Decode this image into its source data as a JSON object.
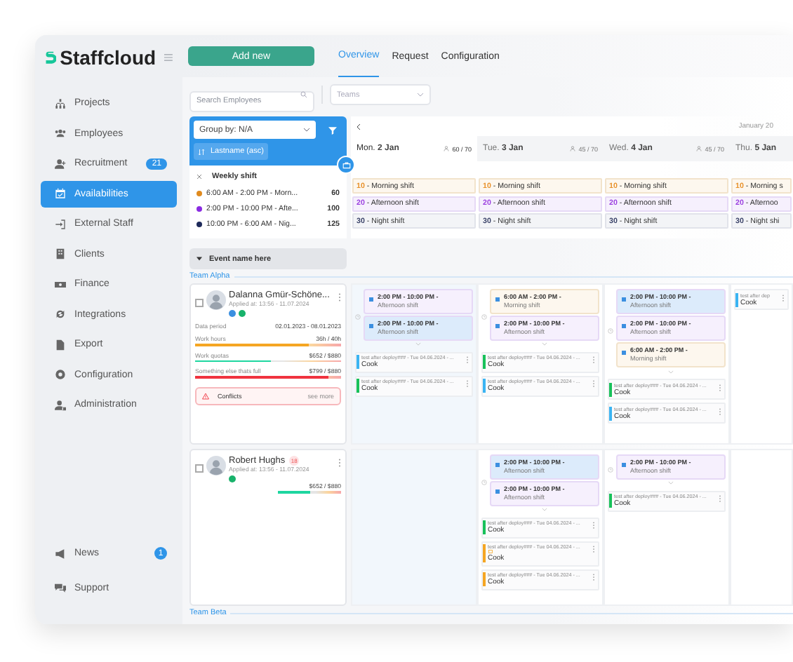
{
  "sidebar": {
    "logo": "Staffcloud",
    "items": [
      {
        "label": "Projects",
        "selected": false
      },
      {
        "label": "Employees",
        "selected": false
      },
      {
        "label": "Recruitment",
        "badge": "21",
        "selected": false
      },
      {
        "label": "Availabilities",
        "selected": true
      },
      {
        "label": "External Staff",
        "selected": false
      },
      {
        "label": "Clients",
        "selected": false
      },
      {
        "label": "Finance",
        "selected": false
      },
      {
        "label": "Integrations",
        "selected": false
      },
      {
        "label": "Export",
        "selected": false
      },
      {
        "label": "Configuration",
        "selected": false
      },
      {
        "label": "Administration",
        "selected": false
      }
    ],
    "bottom_items": [
      {
        "label": "News",
        "badge": "1"
      },
      {
        "label": "Support"
      }
    ]
  },
  "toolbar": {
    "add_button": "Add new",
    "tabs": [
      {
        "label": "Overview",
        "selected": true
      },
      {
        "label": "Request",
        "selected": false
      },
      {
        "label": "Configuration",
        "selected": false
      }
    ]
  },
  "filters": {
    "search": {
      "placeholder": "Search Employees"
    },
    "teams": {
      "placeholder": "Teams"
    }
  },
  "grouping": {
    "group_by": "Group by: N/A",
    "sort": "Lastname (asc)",
    "weekly_shift": {
      "title": "Weekly shift",
      "shifts": [
        {
          "time": "6:00 AM - 2:00 PM - Morn...",
          "count": "60",
          "color": "#e08a1e"
        },
        {
          "time": "2:00 PM - 10:00 PM - Afte...",
          "count": "100",
          "color": "#8a2be2"
        },
        {
          "time": "10:00 PM - 6:00 AM - Nig...",
          "count": "125",
          "color": "#1e2a5a"
        }
      ]
    }
  },
  "calendar": {
    "month": "January 20",
    "days": [
      {
        "weekday": "Mon.",
        "date": "2 Jan",
        "staff": "60 / 70",
        "selected": true,
        "shifts": [
          {
            "count": "10",
            "name": "- Morning shift",
            "kind": "morning"
          },
          {
            "count": "20",
            "name": "- Afternoon shift",
            "kind": "afternoon"
          },
          {
            "count": "30",
            "name": "- Night shift",
            "kind": "night"
          }
        ]
      },
      {
        "weekday": "Tue.",
        "date": "3 Jan",
        "staff": "45 / 70",
        "selected": false,
        "shifts": [
          {
            "count": "10",
            "name": "- Morning shift",
            "kind": "morning"
          },
          {
            "count": "20",
            "name": "- Afternoon shift",
            "kind": "afternoon"
          },
          {
            "count": "30",
            "name": "- Night shift",
            "kind": "night"
          }
        ]
      },
      {
        "weekday": "Wed.",
        "date": "4 Jan",
        "staff": "45 / 70",
        "selected": false,
        "shifts": [
          {
            "count": "10",
            "name": "- Morning shift",
            "kind": "morning"
          },
          {
            "count": "20",
            "name": "- Afternoon shift",
            "kind": "afternoon"
          },
          {
            "count": "30",
            "name": "- Night shift",
            "kind": "night"
          }
        ]
      },
      {
        "weekday": "Thu.",
        "date": "5 Jan",
        "selected": false,
        "shifts": [
          {
            "count": "10",
            "name": "- Morning s",
            "kind": "morning"
          },
          {
            "count": "20",
            "name": "- Afternoo",
            "kind": "afternoon"
          },
          {
            "count": "30",
            "name": "- Night shi",
            "kind": "night"
          }
        ]
      }
    ]
  },
  "event": {
    "name": "Event name here",
    "expanded": true
  },
  "teams": [
    {
      "name": "Team Alpha",
      "employees": [
        {
          "name": "Dalanna Gmür-Schöne...",
          "checked": false,
          "applied": "Applied at: 13:56 - 11.07.2024",
          "badges": [
            {
              "color": "#3b8fe0"
            },
            {
              "color": "#18b26b"
            }
          ],
          "period": {
            "label": "Data period",
            "value": "02.01.2023 - 08.01.2023"
          },
          "stats": [
            {
              "label": "Work hours",
              "value": "36h / 40h",
              "level": 0.78,
              "color": "#f5a623"
            },
            {
              "label": "Work quotas",
              "value": "$652 / $880",
              "level": 0.52,
              "color": "#1ed6a0"
            },
            {
              "label": "Something else thats full",
              "value": "$799 / $880",
              "level": 0.91,
              "color": "#f0333f"
            }
          ],
          "conflicts": {
            "label": "Conflicts",
            "link": "see more"
          },
          "cells": [
            {
              "shifts": [
                {
                  "time": "2:00 PM - 10:00 PM -",
                  "name": "Afternoon shift",
                  "kind": "afternoon",
                  "selected": false
                },
                {
                  "time": "2:00 PM - 10:00 PM -",
                  "name": "Afternoon shift",
                  "kind": "afternoon",
                  "selected": true
                }
              ],
              "assignments": [
                {
                  "title": "test after deploy### - Tue 04.06.2024 - ...",
                  "role": "Cook",
                  "color": "#3bb4f2"
                },
                {
                  "title": "test after deploy### - Tue 04.06.2024 - ...",
                  "role": "Cook",
                  "color": "#18c15a"
                }
              ]
            },
            {
              "shifts": [
                {
                  "time": "6:00 AM - 2:00 PM -",
                  "name": "Morning shift",
                  "kind": "morning",
                  "selected": false
                },
                {
                  "time": "2:00 PM - 10:00 PM -",
                  "name": "Afternoon shift",
                  "kind": "afternoon",
                  "selected": false
                }
              ],
              "assignments": [
                {
                  "title": "test after deploy### - Tue 04.06.2024 - ...",
                  "role": "Cook",
                  "color": "#18c15a"
                },
                {
                  "title": "test after deploy### - Tue 04.06.2024 - ...",
                  "role": "Cook",
                  "color": "#3bb4f2"
                }
              ]
            },
            {
              "shifts": [
                {
                  "time": "2:00 PM - 10:00 PM -",
                  "name": "Afternoon shift",
                  "kind": "afternoon",
                  "selected": true
                },
                {
                  "time": "2:00 PM - 10:00 PM -",
                  "name": "Afternoon shift",
                  "kind": "afternoon",
                  "selected": false
                },
                {
                  "time": "6:00 AM - 2:00 PM -",
                  "name": "Morning shift",
                  "kind": "morning",
                  "selected": false
                }
              ],
              "assignments": [
                {
                  "title": "test after deploy### - Tue 04.06.2024 - ...",
                  "role": "Cook",
                  "color": "#18c15a"
                },
                {
                  "title": "test after deploy### - Tue 04.06.2024 - ...",
                  "role": "Cook",
                  "color": "#3bb4f2"
                }
              ]
            },
            {
              "assignments": [
                {
                  "title": "test after dep",
                  "role": "Cook",
                  "color": "#3bb4f2"
                }
              ]
            }
          ]
        },
        {
          "name": "Robert Hughs",
          "checked": false,
          "tag": "18",
          "applied": "Applied at: 13:56 - 11.07.2024",
          "badges": [
            {
              "color": "#18b26b"
            }
          ],
          "stats": [
            {
              "value": "$652 / $880",
              "level": 0.5,
              "color": "#1ed6a0"
            }
          ],
          "cells": [
            {},
            {
              "shifts": [
                {
                  "time": "2:00 PM - 10:00 PM -",
                  "name": "Afternoon shift",
                  "kind": "afternoon",
                  "selected": true
                },
                {
                  "time": "2:00 PM - 10:00 PM -",
                  "name": "Afternoon shift",
                  "kind": "afternoon",
                  "selected": false
                }
              ],
              "assignments": [
                {
                  "title": "test after deploy### - Tue 04.06.2024 - ...",
                  "role": "Cook",
                  "color": "#18c15a"
                },
                {
                  "title": "test after deploy### - Tue 04.06.2024 - ...",
                  "role": "Cook",
                  "color": "#f5a623",
                  "warning": true
                },
                {
                  "title": "test after deploy### - Tue 04.06.2024 - ...",
                  "role": "Cook",
                  "color": "#f5a623"
                }
              ]
            },
            {
              "shifts": [
                {
                  "time": "2:00 PM - 10:00 PM -",
                  "name": "Afternoon shift",
                  "kind": "afternoon",
                  "selected": false
                }
              ],
              "assignments": [
                {
                  "title": "test after deploy### - Tue 04.06.2024 - ...",
                  "role": "Cook",
                  "color": "#18c15a"
                }
              ]
            },
            {}
          ]
        }
      ]
    },
    {
      "name": "Team Beta"
    }
  ]
}
